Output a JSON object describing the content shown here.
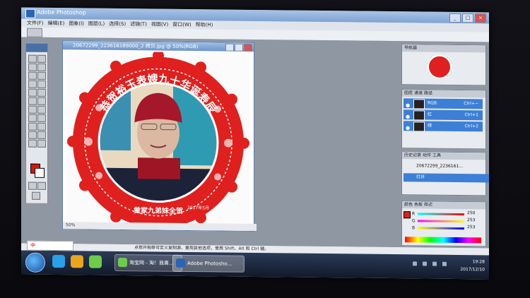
{
  "app": {
    "title": "Adobe Photoshop"
  },
  "menu": [
    "文件(F)",
    "编辑(E)",
    "图象(I)",
    "图层(L)",
    "选择(S)",
    "滤镜(T)",
    "视图(V)",
    "窗口(W)",
    "帮助(H)"
  ],
  "document": {
    "title": "20672299_223616189000_2 拷贝.jpg @ 50%(RGB)",
    "status": "50%"
  },
  "artwork": {
    "top_text": "恭贺裕玉表嫂九十华诞寿辰",
    "bottom_text": "黄家九弟妹全贺",
    "date_text": "2017年5月"
  },
  "panels": {
    "navigator_tabs": [
      "导航器"
    ],
    "layers_tabs": [
      "图层",
      "通道",
      "路径"
    ],
    "channels": [
      {
        "name": "RGB",
        "shortcut": "Ctrl+~"
      },
      {
        "name": "红",
        "shortcut": "Ctrl+1"
      },
      {
        "name": "绿",
        "shortcut": "Ctrl+2"
      }
    ],
    "history_tabs": [
      "历史记录",
      "动作",
      "工具"
    ],
    "history_items": [
      "20672299_2236161...",
      "打开"
    ],
    "color_tabs": [
      "颜色",
      "色板",
      "样式"
    ],
    "color_values": [
      {
        "label": "R",
        "value": "250"
      },
      {
        "label": "G",
        "value": "253"
      },
      {
        "label": "B",
        "value": "253"
      }
    ]
  },
  "hint_text": "点按并拖移可定义复制源，要用其他选项，使用 Shift、Alt 和 Ctrl 键。",
  "taskbar": {
    "ime_label": "中",
    "tasks": [
      "淘宝网 - 淘！我喜...",
      "Adobe Photosho..."
    ],
    "time": "19:28",
    "date": "2017/12/10"
  },
  "colors": {
    "foreground": "#e01010",
    "background": "#ffffff",
    "accent": "#3d7fd6",
    "frame_red": "#e0201e"
  }
}
